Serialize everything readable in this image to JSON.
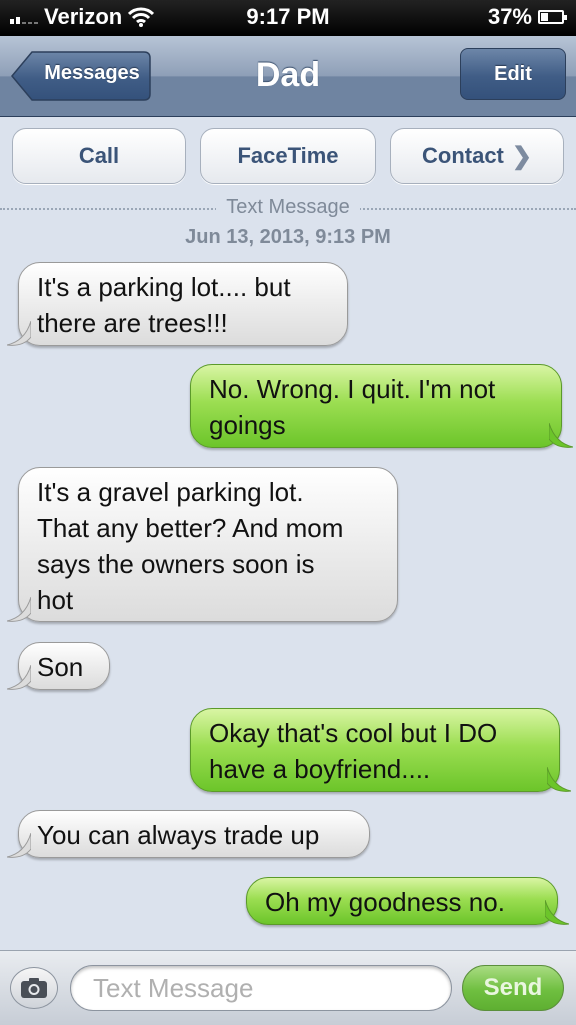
{
  "status_bar": {
    "carrier": "Verizon",
    "time": "9:17 PM",
    "battery_percent": "37%",
    "battery_level": 0.37
  },
  "nav": {
    "back_label": "Messages",
    "title": "Dad",
    "edit_label": "Edit"
  },
  "actions": {
    "call": "Call",
    "facetime": "FaceTime",
    "contact": "Contact"
  },
  "thread": {
    "service_label": "Text Message",
    "timestamp": "Jun 13, 2013, 9:13 PM"
  },
  "messages": [
    {
      "from": "them",
      "lines": [
        "It's a parking lot.... but",
        "there are trees!!!"
      ]
    },
    {
      "from": "me",
      "lines": [
        "No. Wrong. I quit. I'm not",
        "goings"
      ]
    },
    {
      "from": "them",
      "lines": [
        "It's a gravel parking lot.",
        "That any better? And mom",
        "says the owners soon is",
        "hot"
      ]
    },
    {
      "from": "them",
      "lines": [
        "Son"
      ]
    },
    {
      "from": "me",
      "lines": [
        "Okay that's cool but I DO",
        "have a boyfriend...."
      ]
    },
    {
      "from": "them",
      "lines": [
        "You can always trade up"
      ]
    },
    {
      "from": "me",
      "lines": [
        "Oh my goodness no."
      ]
    }
  ],
  "composer": {
    "placeholder": "Text Message",
    "send_label": "Send"
  },
  "colors": {
    "nav_blue": "#6f84a1",
    "sent_green": "#9cde52",
    "received_gray": "#e9e9e9",
    "background": "#dbe2ed"
  }
}
